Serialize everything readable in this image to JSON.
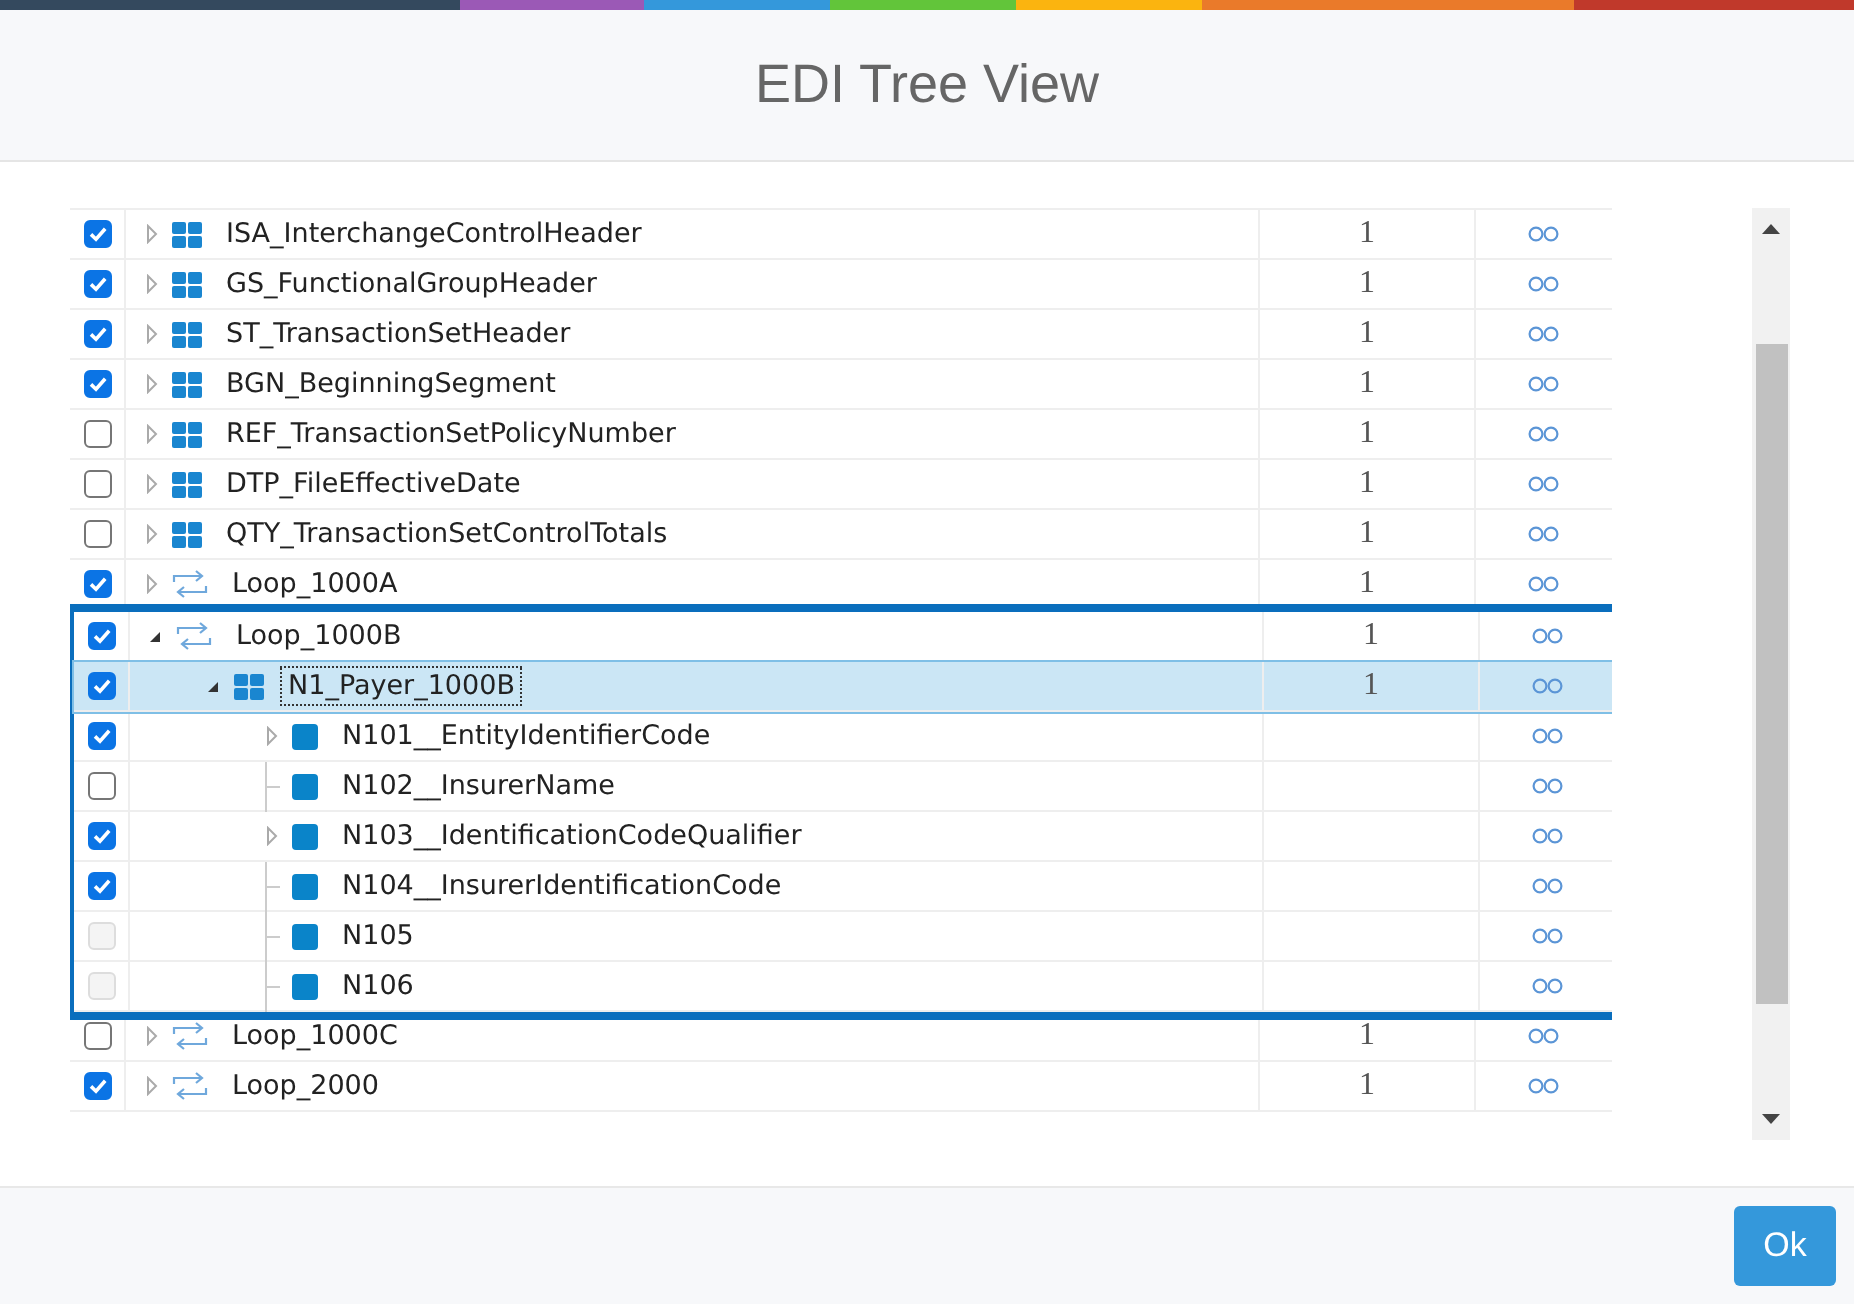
{
  "dialog": {
    "title": "EDI Tree View"
  },
  "tree": [
    {
      "label": "ISA_InterchangeControlHeader",
      "kind": "segment",
      "checked": true,
      "disabled": false,
      "expanded": false,
      "selected": false,
      "count": "1"
    },
    {
      "label": "GS_FunctionalGroupHeader",
      "kind": "segment",
      "checked": true,
      "disabled": false,
      "expanded": false,
      "selected": false,
      "count": "1"
    },
    {
      "label": "ST_TransactionSetHeader",
      "kind": "segment",
      "checked": true,
      "disabled": false,
      "expanded": false,
      "selected": false,
      "count": "1"
    },
    {
      "label": "BGN_BeginningSegment",
      "kind": "segment",
      "checked": true,
      "disabled": false,
      "expanded": false,
      "selected": false,
      "count": "1"
    },
    {
      "label": "REF_TransactionSetPolicyNumber",
      "kind": "segment",
      "checked": false,
      "disabled": false,
      "expanded": false,
      "selected": false,
      "count": "1"
    },
    {
      "label": "DTP_FileEffectiveDate",
      "kind": "segment",
      "checked": false,
      "disabled": false,
      "expanded": false,
      "selected": false,
      "count": "1"
    },
    {
      "label": "QTY_TransactionSetControlTotals",
      "kind": "segment",
      "checked": false,
      "disabled": false,
      "expanded": false,
      "selected": false,
      "count": "1"
    },
    {
      "label": "Loop_1000A",
      "kind": "loop",
      "checked": true,
      "disabled": false,
      "expanded": false,
      "selected": false,
      "count": "1"
    },
    {
      "label": "Loop_1000B",
      "kind": "loop",
      "checked": true,
      "disabled": false,
      "expanded": true,
      "selected": false,
      "highlighted": true,
      "count": "1",
      "children": [
        {
          "label": "N1_Payer_1000B",
          "kind": "segment",
          "checked": true,
          "disabled": false,
          "expanded": true,
          "selected": true,
          "count": "1",
          "children": [
            {
              "label": "N101__EntityIdentifierCode",
              "kind": "element",
              "checked": true,
              "disabled": false,
              "expanded": false,
              "selected": false
            },
            {
              "label": "N102__InsurerName",
              "kind": "element",
              "checked": false,
              "disabled": false,
              "selected": false
            },
            {
              "label": "N103__IdentificationCodeQualifier",
              "kind": "element",
              "checked": true,
              "disabled": false,
              "expanded": false,
              "selected": false
            },
            {
              "label": "N104__InsurerIdentificationCode",
              "kind": "element",
              "checked": true,
              "disabled": false,
              "selected": false
            },
            {
              "label": "N105",
              "kind": "element",
              "checked": false,
              "disabled": true,
              "selected": false
            },
            {
              "label": "N106",
              "kind": "element",
              "checked": false,
              "disabled": true,
              "selected": false
            }
          ]
        }
      ]
    },
    {
      "label": "Loop_1000C",
      "kind": "loop",
      "checked": false,
      "disabled": false,
      "expanded": false,
      "selected": false,
      "count": "1"
    },
    {
      "label": "Loop_2000",
      "kind": "loop",
      "checked": true,
      "disabled": false,
      "expanded": false,
      "selected": false,
      "count": "1"
    }
  ],
  "buttons": [
    {
      "label": "Ok"
    }
  ]
}
